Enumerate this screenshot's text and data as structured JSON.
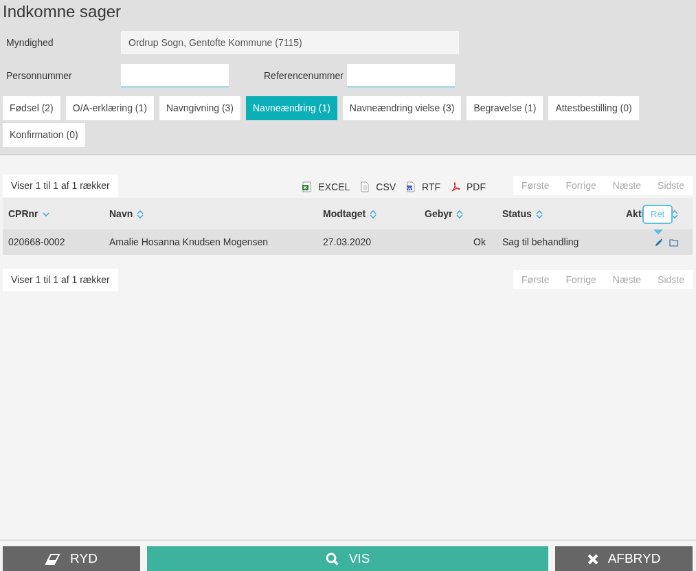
{
  "title": "Indkomne sager",
  "fields": [
    {
      "label": "Myndighed",
      "value": "Ordrup Sogn, Gentofte Kommune (7115)",
      "readonly": true
    }
  ],
  "search_fields": [
    {
      "label": "Personnummer"
    },
    {
      "label": "Referencenummer"
    }
  ],
  "tabs": [
    {
      "label": "Fødsel (2)",
      "selected": false
    },
    {
      "label": "O/A-erklæring (1)",
      "selected": false
    },
    {
      "label": "Navngivning (3)",
      "selected": false
    },
    {
      "label": "Navneændring (1)",
      "selected": true
    },
    {
      "label": "Navneændring vielse (3)",
      "selected": false
    },
    {
      "label": "Begravelse (1)",
      "selected": false
    },
    {
      "label": "Attestbestilling (0)",
      "selected": false
    },
    {
      "label": "Konfirmation (0)",
      "selected": false
    }
  ],
  "info_top": "Viser 1 til 1 af 1 rækker",
  "exports": [
    {
      "kind": "excel",
      "label": "EXCEL"
    },
    {
      "kind": "csv",
      "label": "CSV"
    },
    {
      "kind": "rtf",
      "label": "RTF"
    },
    {
      "kind": "pdf",
      "label": "PDF"
    }
  ],
  "pager_top": [
    {
      "label": "Første",
      "disabled": true
    },
    {
      "label": "Forrige",
      "disabled": true
    },
    {
      "label": "Næste",
      "disabled": true
    },
    {
      "label": "Sidste",
      "disabled": true
    }
  ],
  "table": {
    "columns": [
      {
        "label": "CPRnr",
        "sorted": true
      },
      {
        "label": "Navn",
        "sorted": false
      },
      {
        "label": "Modtaget",
        "sorted": false
      },
      {
        "label": "Gebyr",
        "sorted": false
      },
      {
        "label": "Status",
        "sorted": false
      },
      {
        "label": "Akti",
        "sorted": false
      }
    ],
    "rows": [
      {
        "cells": [
          "020668-0002",
          "Amalie Hosanna Knudsen Mogensen",
          "27.03.2020",
          "Ok",
          "Sag til behandling"
        ],
        "actions": [
          {
            "kind": "edit"
          },
          {
            "kind": "folder"
          }
        ]
      }
    ]
  },
  "tooltip": "Ret",
  "info_bottom": "Viser 1 til 1 af 1 rækker",
  "pager_bottom": [
    {
      "label": "Første",
      "disabled": true
    },
    {
      "label": "Forrige",
      "disabled": true
    },
    {
      "label": "Næste",
      "disabled": true
    },
    {
      "label": "Sidste",
      "disabled": true
    }
  ],
  "buttons": [
    {
      "kind": "clear",
      "label": "RYD"
    },
    {
      "kind": "search",
      "label": "VIS"
    },
    {
      "kind": "cancel",
      "label": "AFBRYD"
    }
  ]
}
